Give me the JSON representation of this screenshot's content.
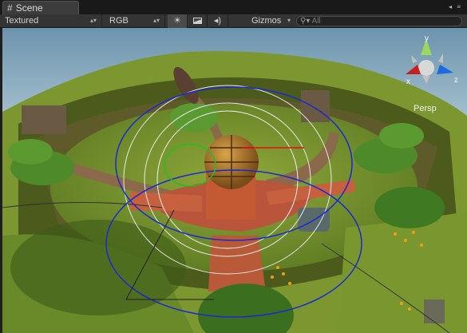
{
  "window": {
    "tab_label": "Scene",
    "tab_icon": "grid-icon"
  },
  "toolbar": {
    "render_mode": "Textured",
    "channel_mode": "RGB",
    "lighting_icon": "sun-icon",
    "image_icon": "image-icon",
    "audio_icon": "speaker-icon",
    "gizmos_label": "Gizmos",
    "search_placeholder": "All"
  },
  "scene_gizmo": {
    "projection_label": "Persp",
    "axis_y": "y",
    "axis_x": "x",
    "axis_z": "z"
  },
  "colors": {
    "sky": "#7fa3b8",
    "terrain": "#6f8a2a",
    "building": "#c8603a",
    "wire_blue": "#1a2ad0",
    "wire_white": "#e8e8e8"
  }
}
